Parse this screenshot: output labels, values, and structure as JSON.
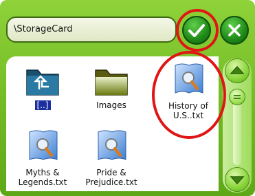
{
  "path": {
    "value": "\\StorageCard"
  },
  "toolbar": {
    "ok_icon": "checkmark-icon",
    "cancel_icon": "close-icon"
  },
  "files": [
    {
      "name": "[..]",
      "icon": "parent-folder-icon"
    },
    {
      "name": "Images",
      "icon": "folder-icon"
    },
    {
      "name": "History of",
      "name2": "U.S..txt",
      "icon": "text-file-icon",
      "highlighted": true
    },
    {
      "name": "Myths &",
      "name2": "Legends.txt",
      "icon": "text-file-icon"
    },
    {
      "name": "Pride &",
      "name2": "Prejudice.txt",
      "icon": "text-file-icon"
    }
  ],
  "scroll": {
    "up_icon": "arrow-up-icon",
    "down_icon": "arrow-down-icon",
    "position": 0.0
  },
  "colors": {
    "frame": "#6fb820",
    "highlight": "#e01515",
    "selection": "#1a2ea0"
  }
}
